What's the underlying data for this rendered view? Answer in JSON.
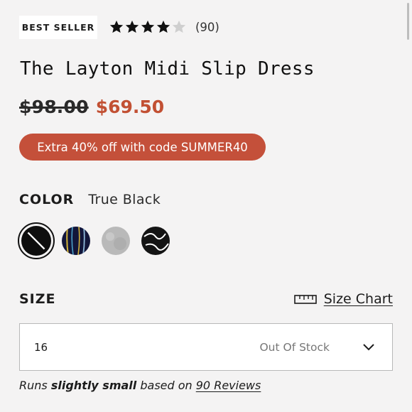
{
  "badge": {
    "label": "BEST SELLER"
  },
  "rating": {
    "stars_filled": 4,
    "stars_total": 5,
    "count_label": "(90)"
  },
  "product": {
    "title": "The Layton Midi Slip Dress",
    "original_price": "$98.00",
    "sale_price": "$69.50",
    "promo": "Extra 40% off with code SUMMER40"
  },
  "color": {
    "label": "COLOR",
    "selected": "True Black",
    "swatches": [
      {
        "name": "true-black",
        "selected": true
      },
      {
        "name": "navy-stripe",
        "selected": false
      },
      {
        "name": "heather-grey",
        "selected": false
      },
      {
        "name": "black-white-abstract",
        "selected": false
      }
    ]
  },
  "size": {
    "label": "SIZE",
    "chart_label": "Size Chart",
    "selected_value": "16",
    "stock_status": "Out Of Stock"
  },
  "fit": {
    "prefix": "Runs ",
    "emphasis": "slightly small",
    "middle": " based on ",
    "link": "90 Reviews"
  },
  "colors": {
    "sale": "#c25033",
    "promo_bg": "#c4503a",
    "background": "#f4f3f3"
  }
}
